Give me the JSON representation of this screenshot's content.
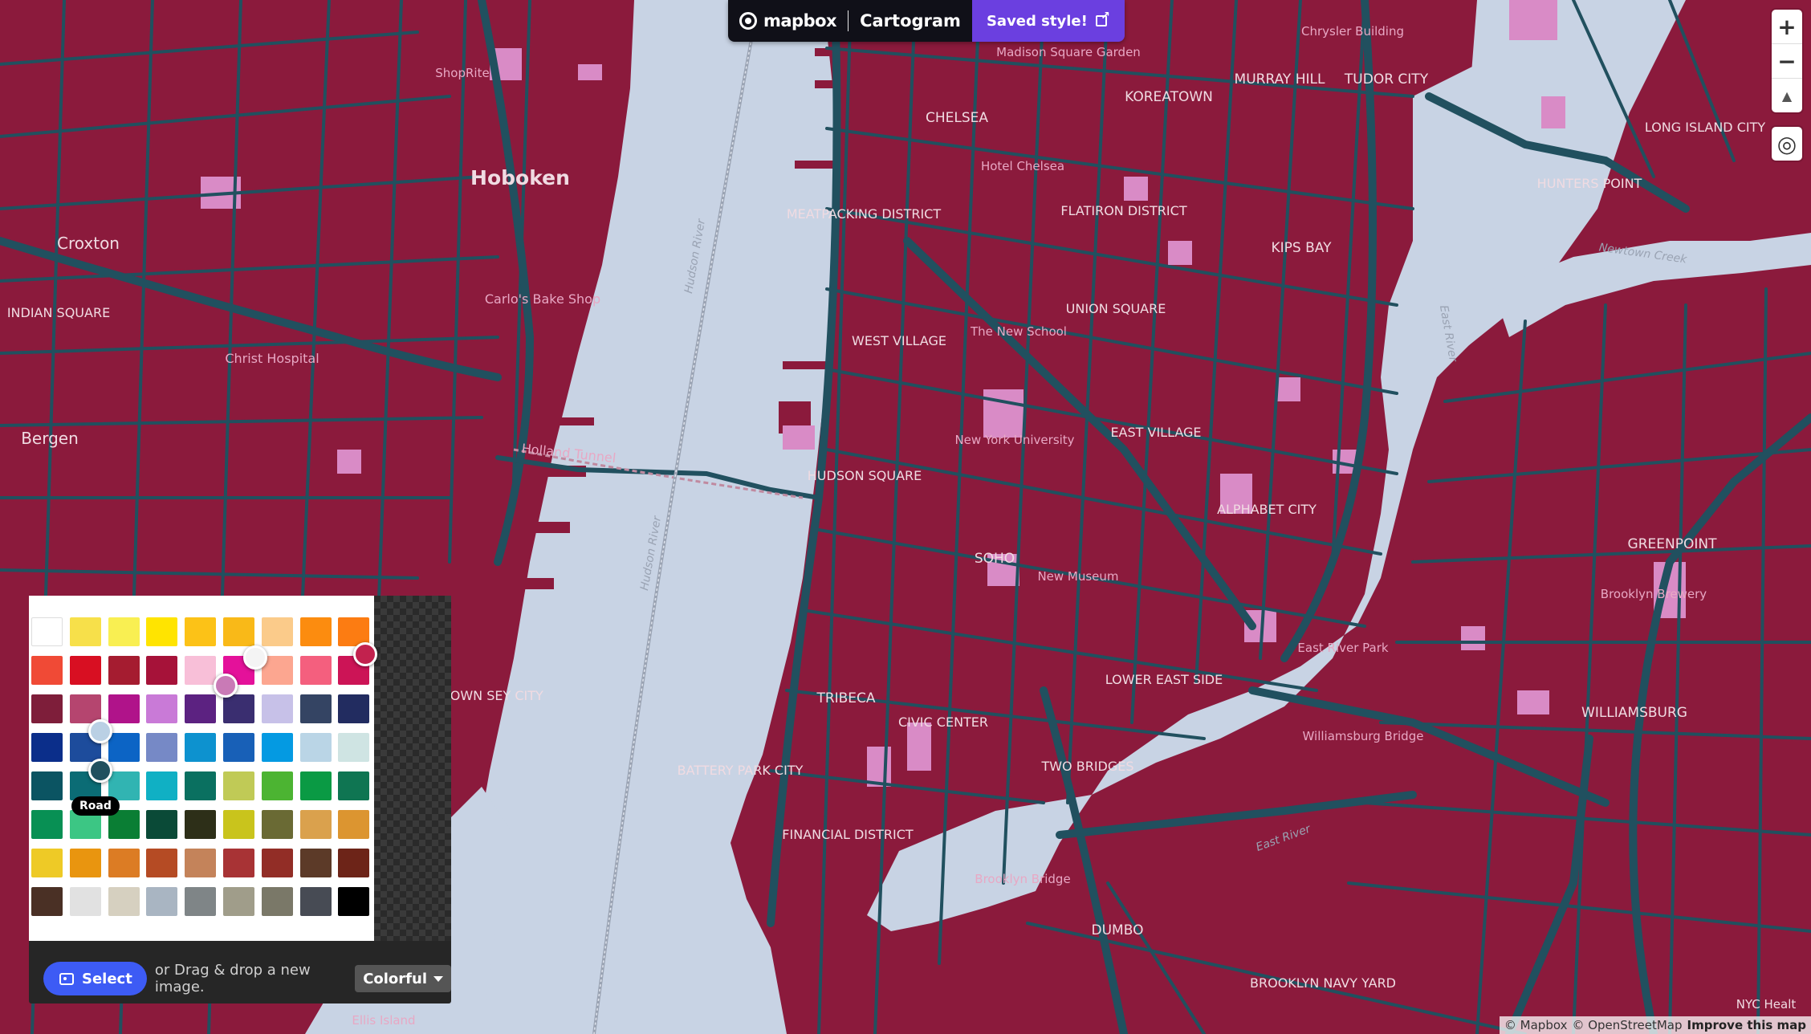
{
  "app": {
    "brand": "mapbox",
    "product": "Cartogram",
    "saved_label": "Saved style!"
  },
  "colors": {
    "land": "#8b1a3c",
    "water": "#c8d3e4",
    "road": "#21505f",
    "park": "#d98bc6",
    "accent": "#6b3fe0",
    "select_button": "#3d5bf5"
  },
  "icons": {
    "logo": "mapbox-logo-icon",
    "saved": "external-link-icon",
    "zoom_in": "plus-icon",
    "zoom_out": "minus-icon",
    "compass": "compass-icon",
    "geolocate": "geolocate-icon",
    "select": "image-icon",
    "dropdown": "chevron-down-icon"
  },
  "controls": {
    "zoom_in": "+",
    "zoom_out": "−",
    "compass": "▲",
    "geolocate": "◎"
  },
  "palette": {
    "swatches": [
      "#ffffff",
      "#f7e04a",
      "#f9ef52",
      "#ffe400",
      "#fcc217",
      "#f9b918",
      "#fbcb8a",
      "#fc8c0f",
      "#fc7c12",
      "#f04a36",
      "#d80f22",
      "#a51c30",
      "#a61239",
      "#f8bfd8",
      "#e4119a",
      "#fca690",
      "#f45f7e",
      "#cc1456",
      "#7e1e3a",
      "#b5456f",
      "#b0138a",
      "#c97ad7",
      "#5c2281",
      "#3a2e70",
      "#c7c1e8",
      "#344463",
      "#222c60",
      "#0b2e8a",
      "#1d4c9c",
      "#0c64c5",
      "#7689c6",
      "#0d92cf",
      "#1860b7",
      "#049ae2",
      "#bad5e6",
      "#cfe4e3",
      "#0b5462",
      "#0b6c75",
      "#31b4b2",
      "#10b0c4",
      "#0a7060",
      "#c0ca56",
      "#4cb432",
      "#0a9a44",
      "#0f7552",
      "#089054",
      "#3cc684",
      "#0a7e34",
      "#0a4a37",
      "#2d2f18",
      "#c9c41c",
      "#6a6a34",
      "#daa14d",
      "#dc9530",
      "#eeca26",
      "#e9950f",
      "#dc7c24",
      "#b54b24",
      "#c4835a",
      "#a83335",
      "#922d26",
      "#5c3a28",
      "#6d2418",
      "#4a3025",
      "#e1e1e1",
      "#d6d0c0",
      "#a9b5c2",
      "#7f8587",
      "#a09d8a",
      "#7a7868",
      "#474b54",
      "#000000"
    ],
    "tooltip": "Road",
    "select_label": "Select",
    "drag_text": "or Drag & drop a new image.",
    "theme": "Colorful"
  },
  "labels": {
    "hoboken": "Hoboken",
    "croxton": "Croxton",
    "indian_square": "INDIAN SQUARE",
    "bergen": "Bergen",
    "shoprite": "ShopRite",
    "christ_hospital": "Christ Hospital",
    "carlos": "Carlo's Bake Shop",
    "holland_tunnel": "Holland Tunnel",
    "hudson_river": "Hudson River",
    "downtown_jc": "WNTOWN SEY CITY",
    "chelsea": "CHELSEA",
    "hotel_chelsea": "Hotel Chelsea",
    "meatpacking": "MEATPACKING DISTRICT",
    "west_village": "WEST VILLAGE",
    "new_school": "The New School",
    "nyu": "New York University",
    "hudson_square": "HUDSON SQUARE",
    "soho": "SOHO",
    "new_museum": "New Museum",
    "tribeca": "TRIBECA",
    "civic_center": "CIVIC CENTER",
    "battery_park": "BATTERY PARK CITY",
    "financial": "FINANCIAL DISTRICT",
    "two_bridges": "TWO BRIDGES",
    "brooklyn_bridge": "Brooklyn Bridge",
    "dumbo": "DUMBO",
    "brooklyn_navy": "BROOKLYN NAVY YARD",
    "madison_sq": "Madison Square Garden",
    "koreatown": "KOREATOWN",
    "murray_hill": "MURRAY HILL",
    "tudor_city": "TUDOR CITY",
    "chrysler": "Chrysler Building",
    "flatiron": "FLATIRON DISTRICT",
    "kips_bay": "KIPS BAY",
    "union_sq": "UNION SQUARE",
    "east_village": "EAST VILLAGE",
    "alphabet": "ALPHABET CITY",
    "lower_east": "LOWER EAST SIDE",
    "east_river_park": "East River Park",
    "williamsburg_bridge": "Williamsburg Bridge",
    "east_river": "East River",
    "long_island_city": "LONG ISLAND CITY",
    "hunters_point": "HUNTERS POINT",
    "greenpoint": "GREENPOINT",
    "brooklyn_brewery": "Brooklyn Brewery",
    "williamsburg": "WILLIAMSBURG",
    "newtown_creek": "Newtown Creek",
    "ellis_island": "Ellis Island",
    "nyc_health": "NYC Healt"
  },
  "attribution": {
    "mapbox": "© Mapbox",
    "osm": "© OpenStreetMap",
    "improve": "Improve this map"
  }
}
